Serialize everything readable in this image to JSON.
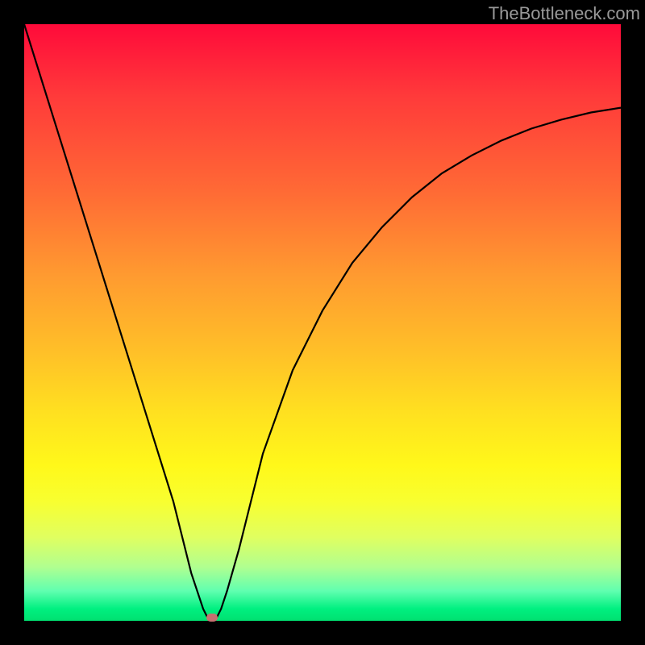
{
  "chart_data": {
    "type": "line",
    "title": "",
    "xlabel": "",
    "ylabel": "",
    "xlim": [
      0,
      100
    ],
    "ylim": [
      0,
      100
    ],
    "x": [
      0,
      5,
      10,
      15,
      20,
      25,
      28,
      30,
      31,
      32,
      33,
      34,
      36,
      38,
      40,
      45,
      50,
      55,
      60,
      65,
      70,
      75,
      80,
      85,
      90,
      95,
      100
    ],
    "y": [
      100,
      84,
      68,
      52,
      36,
      20,
      8,
      2,
      0,
      0,
      2,
      5,
      12,
      20,
      28,
      42,
      52,
      60,
      66,
      71,
      75,
      78,
      80.5,
      82.5,
      84,
      85.2,
      86
    ],
    "annotations": [
      {
        "type": "marker",
        "x": 31.5,
        "y": 0.5,
        "label": "bottleneck-point"
      }
    ]
  },
  "watermark": "TheBottleneck.com",
  "colors": {
    "curve": "#000000",
    "marker": "#c77070",
    "frame": "#000000"
  }
}
